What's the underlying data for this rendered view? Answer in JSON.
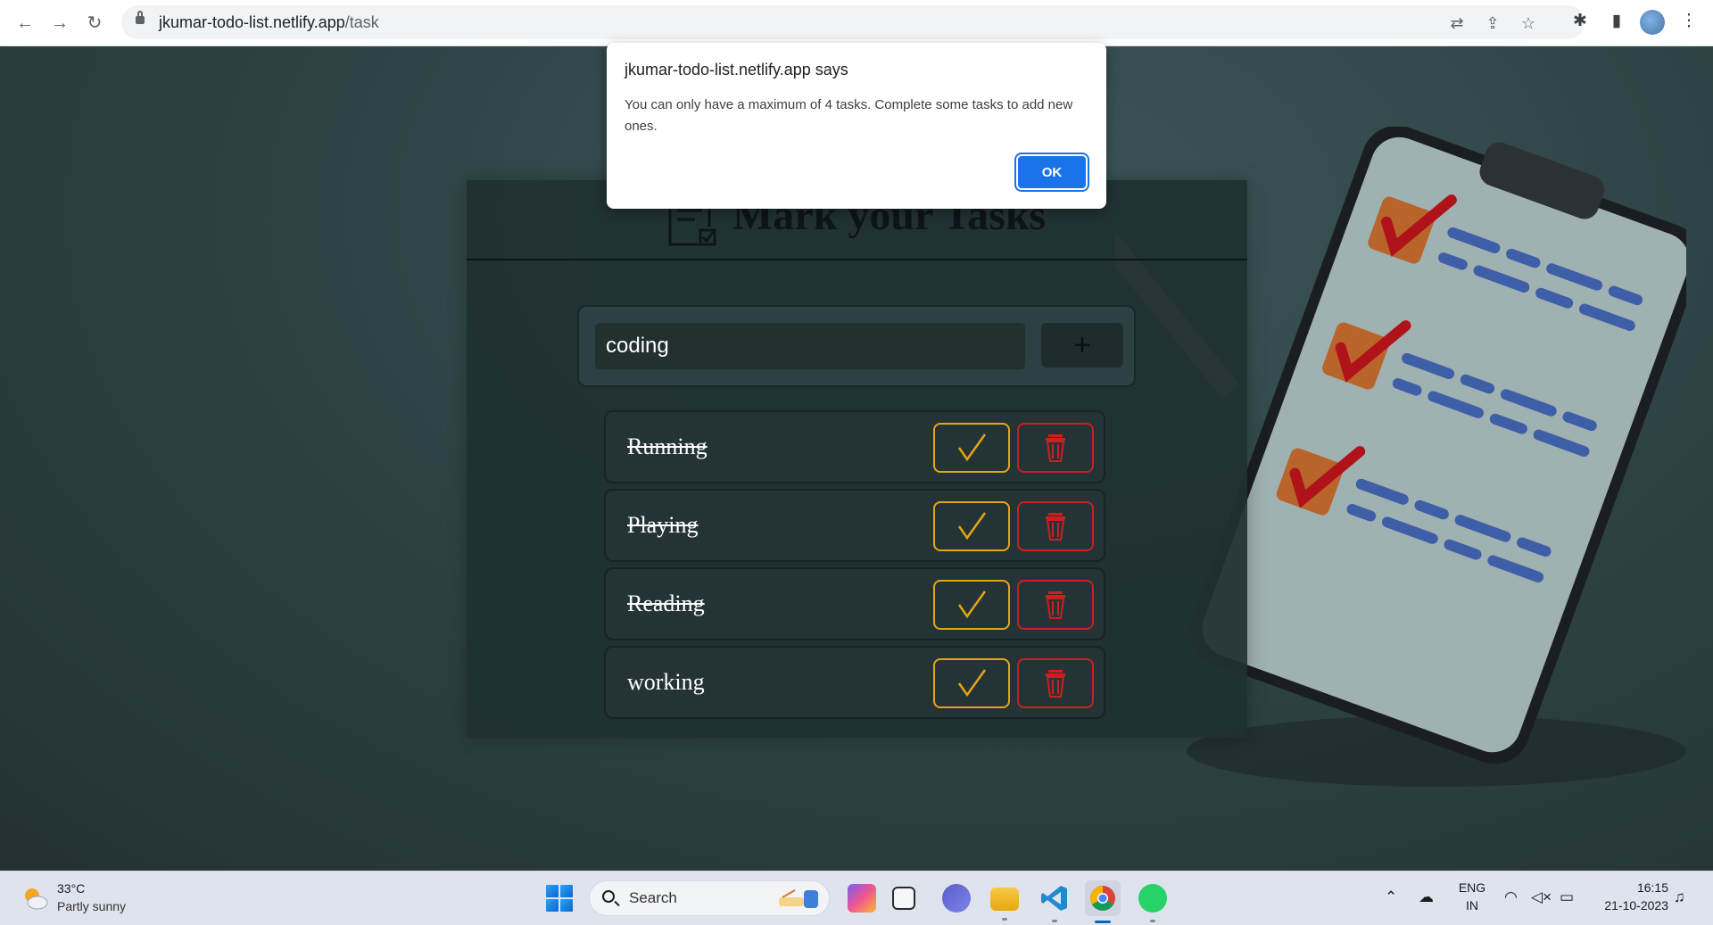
{
  "browser": {
    "url_host": "jkumar-todo-list.netlify.app",
    "url_path": "/task"
  },
  "app": {
    "title": "Mark your Tasks",
    "input_value": "coding",
    "add_button_label": "+",
    "tasks": [
      {
        "label": "Running",
        "done": true
      },
      {
        "label": "Playing",
        "done": true
      },
      {
        "label": "Reading",
        "done": true
      },
      {
        "label": "working",
        "done": false
      }
    ],
    "colors": {
      "done_border": "#e5a512",
      "delete_border": "#cc1f1f",
      "background": "#2f4446"
    }
  },
  "dialog": {
    "title": "jkumar-todo-list.netlify.app says",
    "message": "You can only have a maximum of 4 tasks. Complete some tasks to add new ones.",
    "ok_label": "OK"
  },
  "taskbar": {
    "weather_temp": "33°C",
    "weather_desc": "Partly sunny",
    "search_label": "Search",
    "lang_line1": "ENG",
    "lang_line2": "IN",
    "time": "16:15",
    "date": "21-10-2023",
    "apps": [
      "copilot-icon",
      "file-explorer-window-icon",
      "teams-chat-icon",
      "folder-icon",
      "vscode-icon",
      "chrome-icon",
      "whatsapp-icon"
    ]
  }
}
